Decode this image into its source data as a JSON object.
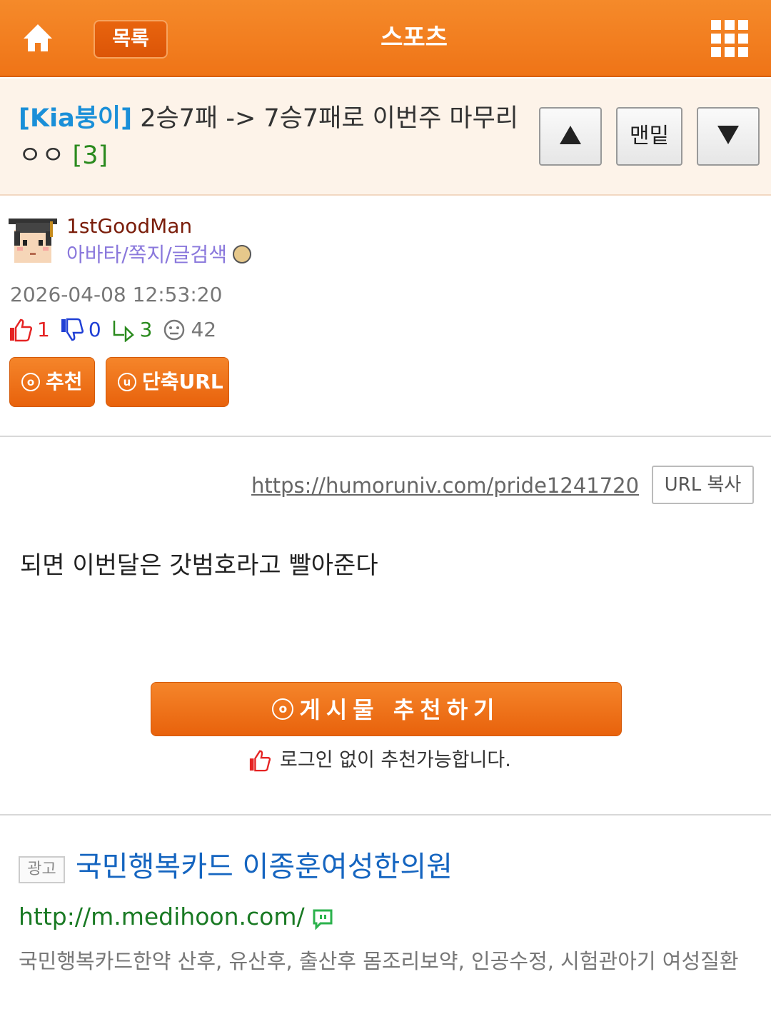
{
  "header": {
    "list_label": "목록",
    "title": "스포츠",
    "bg_color": "#ef7417"
  },
  "post": {
    "category": "[Kia붕이]",
    "title": "2승7패 -> 7승7패로 이번주 마무리 ㅇㅇ",
    "comment_count": "[3]",
    "nav_up_icon": "arrow-up-icon",
    "nav_bottom_label": "맨밑",
    "nav_down_icon": "arrow-down-icon"
  },
  "author": {
    "name": "1stGoodMan",
    "links": "아바타/쪽지/글검색",
    "date": "2026-04-08 12:53:20"
  },
  "stats": {
    "likes": "1",
    "dislikes": "0",
    "replies": "3",
    "views": "42"
  },
  "actions": {
    "recommend_label": "추천",
    "short_url_label": "단축URL",
    "recommend_circle": "o",
    "short_url_circle": "u"
  },
  "body": {
    "url": "https://humoruniv.com/pride1241720",
    "copy_label": "URL 복사",
    "text": "되면 이번달은 갓범호라고 빨아준다"
  },
  "recommend_block": {
    "button_label": "게시물  추천하기",
    "note": "로그인 없이 추천가능합니다."
  },
  "ad": {
    "tag": "광고",
    "title": "국민행복카드 이종훈여성한의원",
    "url": "http://m.medihoon.com/",
    "description": "국민행복카드한약 산후, 유산후, 출산후 몸조리보약, 인공수정, 시험관아기 여성질환"
  }
}
